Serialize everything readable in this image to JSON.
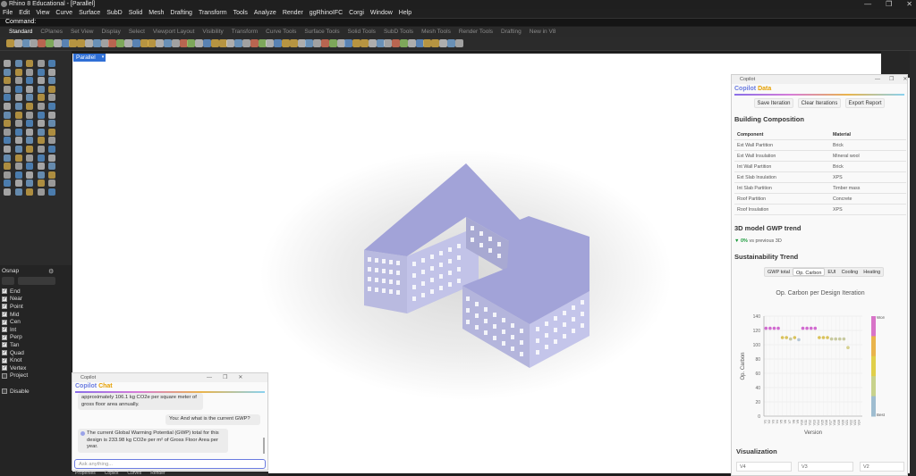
{
  "app": {
    "title": "Rhino 8 Educational - [Parallel]",
    "window_controls": [
      "—",
      "❐",
      "✕"
    ],
    "menu": [
      "File",
      "Edit",
      "View",
      "Curve",
      "Surface",
      "SubD",
      "Solid",
      "Mesh",
      "Drafting",
      "Transform",
      "Tools",
      "Analyze",
      "Render",
      "ggRhinoIFC",
      "Corgi",
      "Window",
      "Help"
    ],
    "command_label": "Command:",
    "toolbar_tabs": [
      "Standard",
      "CPlanes",
      "Set View",
      "Display",
      "Select",
      "Viewport Layout",
      "Visibility",
      "Transform",
      "Curve Tools",
      "Surface Tools",
      "Solid Tools",
      "SubD Tools",
      "Mesh Tools",
      "Render Tools",
      "Drafting",
      "New in V8"
    ],
    "active_tab": "Standard"
  },
  "viewport": {
    "tab_label": "Parallel",
    "tab_arrow": "▾"
  },
  "osnap": {
    "title": "Osnap",
    "items": [
      {
        "label": "End",
        "checked": true
      },
      {
        "label": "Near",
        "checked": true
      },
      {
        "label": "Point",
        "checked": true
      },
      {
        "label": "Mid",
        "checked": true
      },
      {
        "label": "Cen",
        "checked": true
      },
      {
        "label": "Int",
        "checked": true
      },
      {
        "label": "Perp",
        "checked": true
      },
      {
        "label": "Tan",
        "checked": true
      },
      {
        "label": "Quad",
        "checked": true
      },
      {
        "label": "Knot",
        "checked": true
      },
      {
        "label": "Vertex",
        "checked": true
      },
      {
        "label": "Project",
        "checked": false
      }
    ],
    "disable_label": "Disable"
  },
  "data_panel": {
    "window_title": "Copilot",
    "brand_a": "Copilot",
    "brand_b": "Data",
    "buttons": [
      "Save Iteration",
      "Clear Iterations",
      "Export Report"
    ],
    "composition_heading": "Building Composition",
    "table_headers": [
      "Component",
      "Material"
    ],
    "table_rows": [
      [
        "Ext Wall Partition",
        "Brick"
      ],
      [
        "Ext Wall Insulation",
        "Mineral wool"
      ],
      [
        "Int Wall Partition",
        "Brick"
      ],
      [
        "Ext Slab Insulation",
        "XPS"
      ],
      [
        "Int Slab Partition",
        "Timber mass"
      ],
      [
        "Roof Partition",
        "Concrete"
      ],
      [
        "Roof Insulation",
        "XPS"
      ]
    ],
    "gwp_heading": "3D model GWP trend",
    "gwp_change": "▼ 0%",
    "gwp_change_suffix": "vs previous 3D",
    "sustain_heading": "Sustainability Trend",
    "trend_tabs": [
      "GWP total",
      "Op. Carbon",
      "EUI",
      "Cooling",
      "Heating"
    ],
    "trend_active": "Op. Carbon",
    "viz_heading": "Visualization",
    "viz_inputs": [
      "V4",
      "V3",
      "V2"
    ]
  },
  "chart_data": {
    "type": "scatter",
    "title": "Op. Carbon per Design Iteration",
    "xlabel": "Version",
    "ylabel": "Op. Carbon",
    "ylim": [
      0,
      140
    ],
    "yticks": [
      0,
      20,
      40,
      60,
      80,
      100,
      120,
      140
    ],
    "x": [
      "V1",
      "V2",
      "V3",
      "V4",
      "V5",
      "V6",
      "V7",
      "V8",
      "V9",
      "V10",
      "V11",
      "V12",
      "V13",
      "V14",
      "V15",
      "V16",
      "V17",
      "V18",
      "V19",
      "V20",
      "V21",
      "V22",
      "V23",
      "V24"
    ],
    "values": [
      123,
      123,
      123,
      123,
      110,
      110,
      108,
      110,
      107,
      123,
      123,
      123,
      123,
      110,
      110,
      110,
      108,
      108,
      108,
      108,
      96,
      null,
      null,
      null
    ],
    "colorbar": {
      "top_label": "Worst",
      "bottom_label": "Best",
      "colors": [
        "#d874c8",
        "#e9b44c",
        "#e0cf4a",
        "#c8d28c",
        "#9fbdd0"
      ]
    },
    "point_colors": [
      "#d16bd0",
      "#d16bd0",
      "#d16bd0",
      "#d16bd0",
      "#d9c25a",
      "#d9c25a",
      "#c7c9a0",
      "#d9c25a",
      "#b6c7d6",
      "#d16bd0",
      "#d16bd0",
      "#d16bd0",
      "#d16bd0",
      "#d9c25a",
      "#d9c25a",
      "#d9c25a",
      "#c7c9a0",
      "#c7c9a0",
      "#c7c9a0",
      "#c7c9a0",
      "#d6d090"
    ]
  },
  "chat": {
    "window_title": "Copilot",
    "brand_a": "Copilot",
    "brand_b": "Chat",
    "msg1": "approximately 106.1 kg CO2e per square meter of gross floor area annually.",
    "msg2": "You: And what is the current GWP?",
    "msg3": "The current Global Warming Potential (GWP) total for this design is 233.98 kg CO2e per m² of Gross Floor Area per year.",
    "placeholder": "Ask anything..."
  },
  "bottom_tabs": [
    "Properties",
    "Copilot",
    "Curves",
    "Render"
  ]
}
